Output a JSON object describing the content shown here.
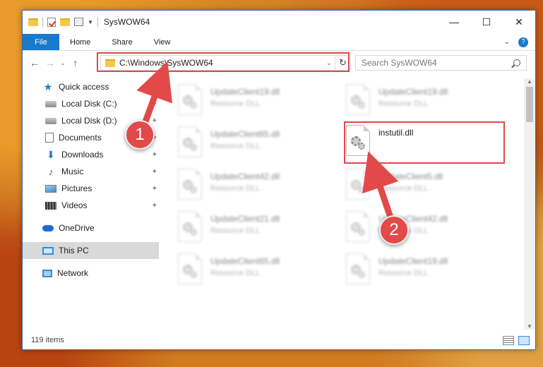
{
  "window": {
    "title": "SysWOW64",
    "controls": {
      "minimize": "—",
      "maximize": "☐",
      "close": "✕"
    }
  },
  "ribbon": {
    "tabs": [
      "File",
      "Home",
      "Share",
      "View"
    ],
    "expand": "⌄",
    "help": "?"
  },
  "nav": {
    "back": "←",
    "forward": "→",
    "recent": "⌄",
    "up": "↑",
    "address": "C:\\Windows\\SysWOW64",
    "address_chevron": "⌄",
    "refresh": "↻",
    "search_placeholder": "Search SysWOW64"
  },
  "sidebar": {
    "items": [
      {
        "label": "Quick access",
        "icon": "star-icon"
      },
      {
        "label": "Local Disk (C:)",
        "icon": "drive-icon",
        "pinned": true
      },
      {
        "label": "Local Disk (D:)",
        "icon": "drive-icon",
        "pinned": true
      },
      {
        "label": "Documents",
        "icon": "documents-icon",
        "pinned": true
      },
      {
        "label": "Downloads",
        "icon": "download-icon",
        "pinned": true
      },
      {
        "label": "Music",
        "icon": "music-icon",
        "pinned": true
      },
      {
        "label": "Pictures",
        "icon": "pictures-icon",
        "pinned": true
      },
      {
        "label": "Videos",
        "icon": "videos-icon",
        "pinned": true
      },
      {
        "label": "OneDrive",
        "icon": "onedrive-icon"
      },
      {
        "label": "This PC",
        "icon": "pc-icon",
        "selected": true
      },
      {
        "label": "Network",
        "icon": "network-icon"
      }
    ],
    "pin_glyph": "📌"
  },
  "files": [
    {
      "name": "UpdateClient19.dll",
      "type": "Resource DLL"
    },
    {
      "name": "UpdateClient19.dll",
      "type": "Resource DLL"
    },
    {
      "name": "UpdateClient65.dll",
      "type": "Resource DLL"
    },
    {
      "name": "instutil.dll",
      "type": ""
    },
    {
      "name": "UpdateClient42.dll",
      "type": "Resource DLL"
    },
    {
      "name": "UpdateClient5.dll",
      "type": "Resource DLL"
    },
    {
      "name": "UpdateClient21.dll",
      "type": "Resource DLL"
    },
    {
      "name": "UpdateClient42.dll",
      "type": "Resource DLL"
    },
    {
      "name": "UpdateClient65.dll",
      "type": "Resource DLL"
    },
    {
      "name": "UpdateClient19.dll",
      "type": "Resource DLL"
    }
  ],
  "annotations": {
    "step1": "1",
    "step2": "2"
  },
  "status": {
    "item_count": "119 items"
  },
  "colors": {
    "accent": "#1979ca",
    "highlight": "#e04848",
    "badge": "#e24a4a"
  }
}
